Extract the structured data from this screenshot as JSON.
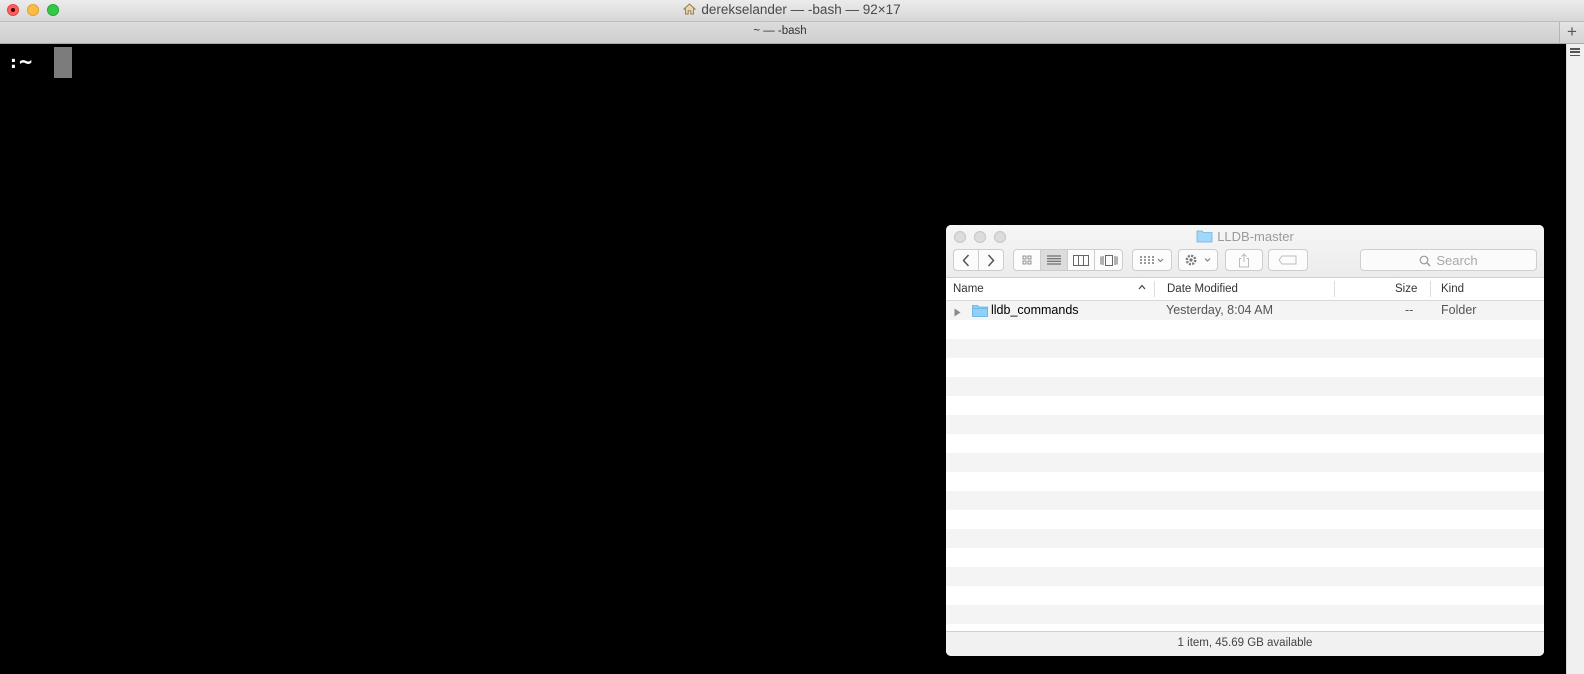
{
  "terminal": {
    "title": "derekselander — -bash — 92×17",
    "tab_title": "~ — -bash",
    "new_tab_label": "+",
    "prompt_prefix": ":",
    "prompt_dir": "~"
  },
  "finder": {
    "title": "LLDB-master",
    "search_placeholder": "Search",
    "columns": {
      "name": "Name",
      "date": "Date Modified",
      "size": "Size",
      "kind": "Kind"
    },
    "rows": [
      {
        "name": "lldb_commands",
        "date": "Yesterday, 8:04 AM",
        "size": "--",
        "kind": "Folder"
      }
    ],
    "status": "1 item, 45.69 GB available"
  },
  "colors": {
    "terminal_bg": "#000000",
    "cursor": "#7c7c7c",
    "folder_blue": "#6ec3f5",
    "close_red": "#fc605c",
    "minimize_yellow": "#fdbc40",
    "zoom_green": "#34c84a"
  },
  "icons": [
    "home-icon",
    "folder-icon",
    "chevron-left-icon",
    "chevron-right-icon",
    "icon-view-icon",
    "list-view-icon",
    "column-view-icon",
    "cover-flow-icon",
    "arrange-icon",
    "gear-icon",
    "share-icon",
    "tag-icon",
    "search-icon",
    "disclosure-triangle-icon"
  ]
}
